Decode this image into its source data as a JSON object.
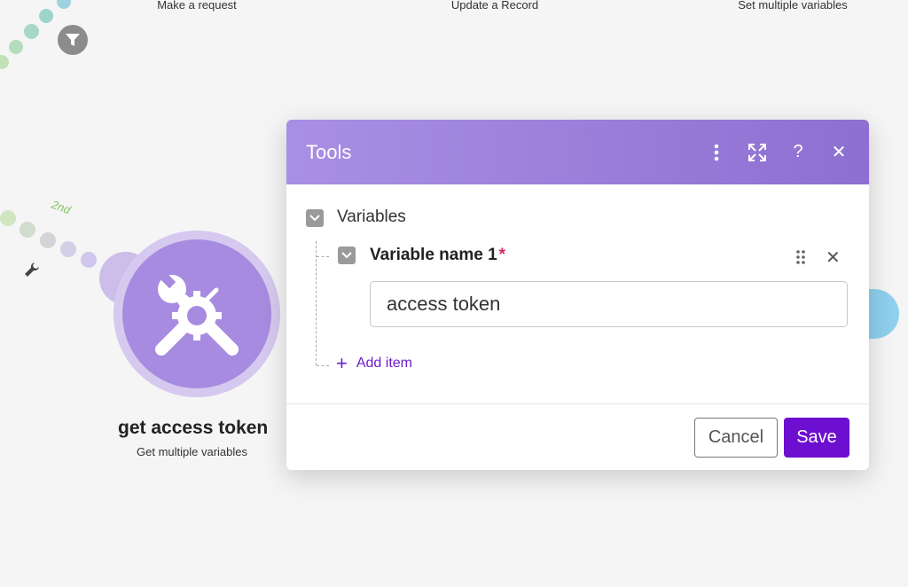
{
  "canvas": {
    "top_modules": [
      {
        "label": "Make a request"
      },
      {
        "label": "Update a Record"
      },
      {
        "label": "Set multiple variables"
      }
    ],
    "order_label": "2nd",
    "filter_icon": "filter-icon",
    "wrench_icon": "wrench-icon",
    "module": {
      "title": "get access token",
      "subtitle": "Get multiple variables",
      "icon": "tools-icon",
      "color": "#a78be0"
    }
  },
  "dialog": {
    "title": "Tools",
    "header_color": "#9b7fdc",
    "header_icons": [
      "more-vertical-icon",
      "expand-icon",
      "help-icon",
      "close-icon"
    ],
    "help_glyph": "?",
    "close_glyph": "✕",
    "section": {
      "label": "Variables",
      "items": [
        {
          "label": "Variable name 1",
          "required_marker": "*",
          "value": "access token"
        }
      ],
      "add_item_label": "Add item",
      "add_item_glyph": "+"
    },
    "footer": {
      "cancel_label": "Cancel",
      "save_label": "Save",
      "save_color": "#6d0fd0"
    }
  }
}
